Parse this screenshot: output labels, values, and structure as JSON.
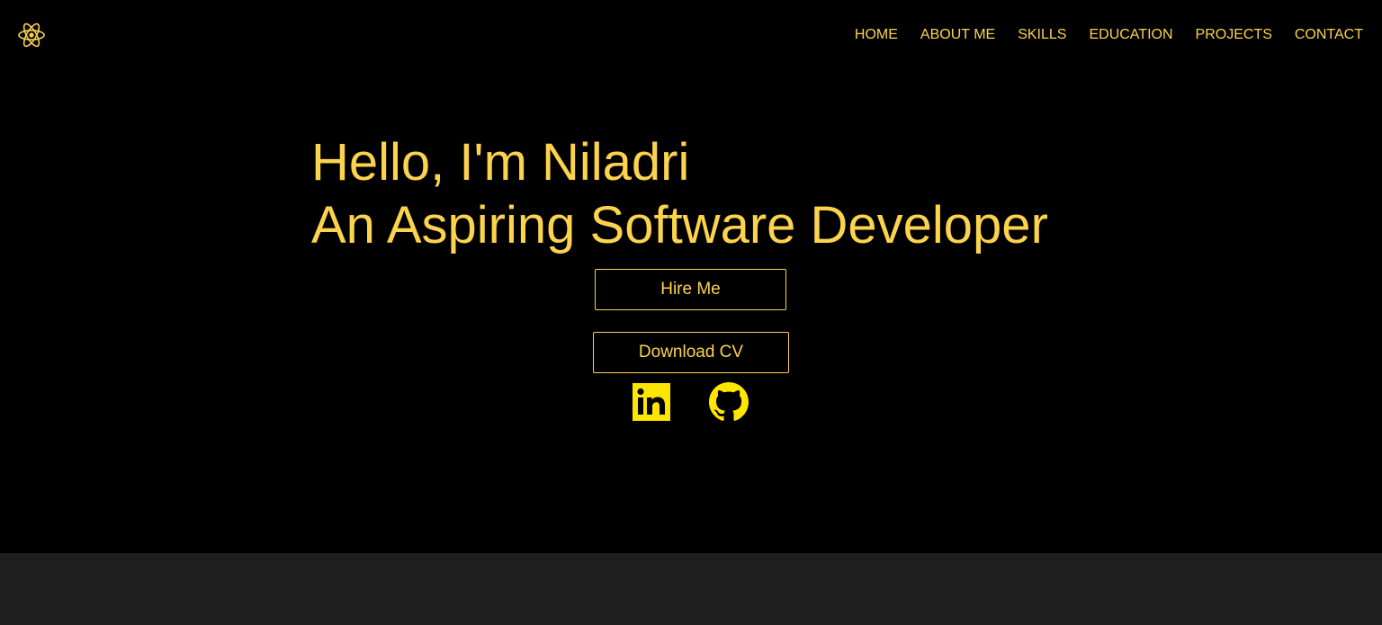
{
  "colors": {
    "accent": "#fcd34d",
    "icon_accent": "#ffe600",
    "background": "#000000",
    "next_section": "#1e1e1e"
  },
  "header": {
    "logo_icon": "react-atom-icon",
    "nav": [
      {
        "label": "HOME"
      },
      {
        "label": "ABOUT ME"
      },
      {
        "label": "SKILLS"
      },
      {
        "label": "EDUCATION"
      },
      {
        "label": "PROJECTS"
      },
      {
        "label": "CONTACT"
      }
    ]
  },
  "hero": {
    "greeting": "Hello, I'm Niladri",
    "tagline": "An Aspiring Software Developer",
    "hire_button": "Hire Me",
    "cv_button": "Download CV",
    "social": [
      {
        "icon": "linkedin-icon"
      },
      {
        "icon": "github-icon"
      }
    ]
  }
}
